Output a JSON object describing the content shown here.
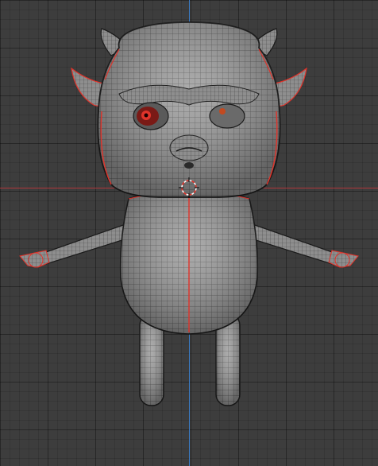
{
  "viewport": {
    "background": "#3d3d3d",
    "x_axis_color": "#b0363a",
    "z_axis_color": "#3a7ac2",
    "selection_outline_color": "#e0332a",
    "mesh_color": "#a8a8a8"
  },
  "scene": {
    "object": "devil-character-mesh",
    "mode": "edit-mode-wireframe",
    "cursor_icon": "3d-cursor-icon"
  }
}
